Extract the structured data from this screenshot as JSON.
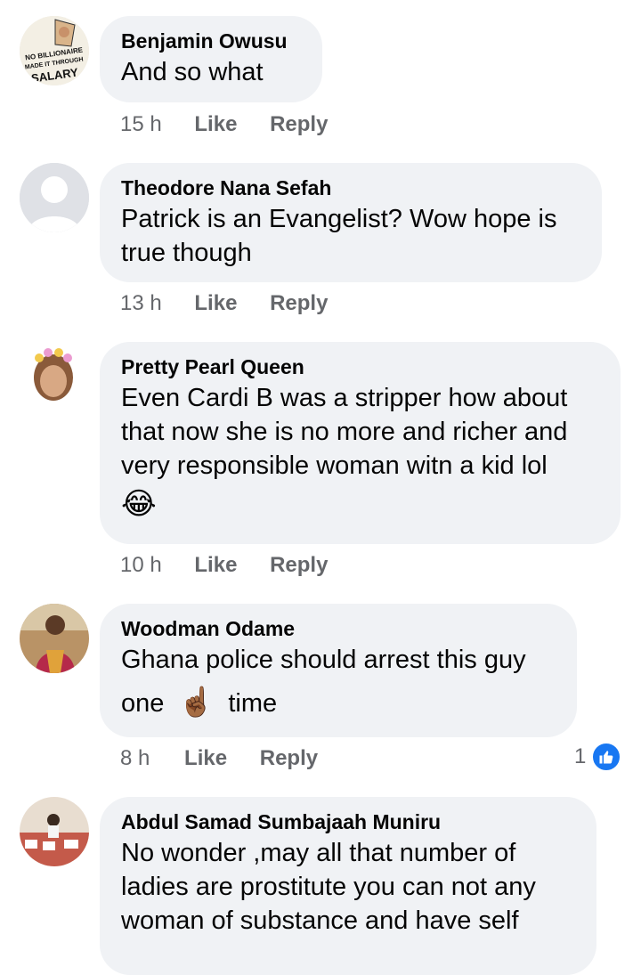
{
  "comments": [
    {
      "author": "Benjamin Owusu",
      "avatar_text": [
        "NO BILLIONAIRE",
        "MADE IT THROUGH",
        "SALARY"
      ],
      "text": "And so what",
      "time": "15 h",
      "like_label": "Like",
      "reply_label": "Reply"
    },
    {
      "author": "Theodore Nana Sefah",
      "avatar": "default-profile",
      "text_lines": [
        "Patrick is an Evangelist? Wow hope is",
        "true though"
      ],
      "time": "13 h",
      "like_label": "Like",
      "reply_label": "Reply"
    },
    {
      "author": "Pretty Pearl Queen",
      "avatar": "photo",
      "text_lines": [
        "Even Cardi B was a stripper how about",
        "that now she is no more and richer and",
        "very responsible woman witn a kid lol"
      ],
      "emoji": "😂",
      "time": "10 h",
      "like_label": "Like",
      "reply_label": "Reply"
    },
    {
      "author": "Woodman Odame",
      "avatar": "photo",
      "text_lines": [
        "Ghana police should arrest this guy"
      ],
      "text_line2_a": "one",
      "text_emoji": "☝🏾",
      "text_line2_b": "time",
      "time": "8 h",
      "like_label": "Like",
      "reply_label": "Reply",
      "reaction_count": "1"
    },
    {
      "author": "Abdul Samad Sumbajaah Muniru",
      "avatar": "photo",
      "text_lines": [
        "No wonder ,may all that number of",
        "ladies are  prostitute you can not any",
        "woman of substance and have self"
      ]
    }
  ],
  "colors": {
    "bubble": "#f0f2f5",
    "meta": "#65676b",
    "like_blue": "#1877f2"
  }
}
